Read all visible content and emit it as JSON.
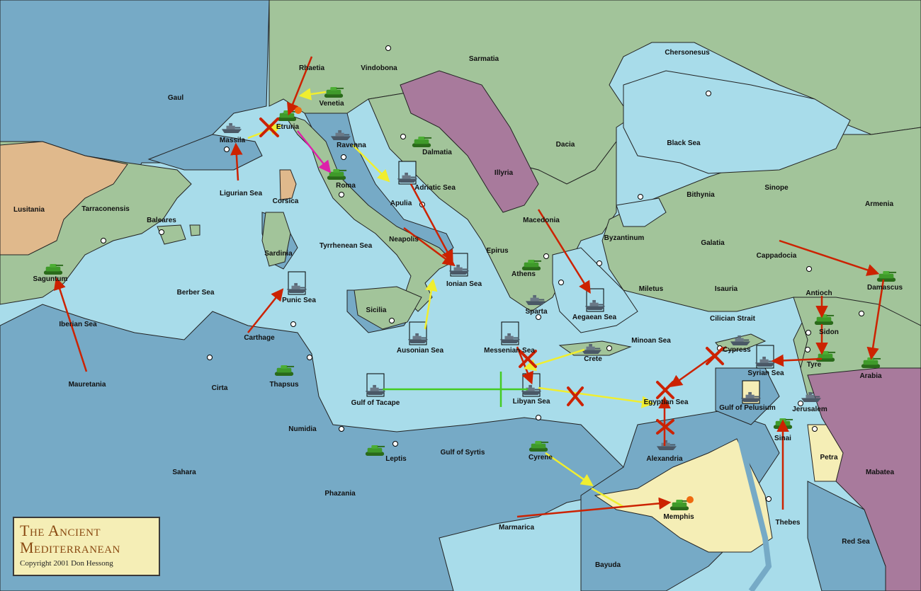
{
  "title": {
    "line1": "The Ancient",
    "line2": "Mediterranean",
    "copyright": "Copyright  2001  Don Hessong"
  },
  "colors": {
    "sea_light": "#a8dcea",
    "sea_dark": "#76aac6",
    "land_green": "#a2c49a",
    "land_lowland": "#9ebfa0",
    "land_tan": "#e0b98c",
    "land_purple": "#a87a9c",
    "land_yellow": "#f5eeb6",
    "order_red": "#cc2200",
    "order_yellow": "#f0ee30",
    "order_magenta": "#dd22aa",
    "order_green": "#44cc22"
  },
  "regions": [
    "Gaul",
    "Rhaetia",
    "Vindobona",
    "Sarmatia",
    "Chersonesus",
    "Venetia",
    "Etruria",
    "Massila",
    "Ravenna",
    "Dalmatia",
    "Dacia",
    "Black Sea",
    "Illyria",
    "Roma",
    "Adriatic Sea",
    "Ligurian Sea",
    "Corsica",
    "Lusitania",
    "Tarraconensis",
    "Baleares",
    "Apulia",
    "Macedonia",
    "Bithynia",
    "Sinope",
    "Armenia",
    "Sardinia",
    "Tyrrhenean Sea",
    "Neapolis",
    "Byzantinum",
    "Galatia",
    "Epirus",
    "Cappadocia",
    "Saguntum",
    "Athens",
    "Ionian Sea",
    "Miletus",
    "Isauria",
    "Berber Sea",
    "Punic Sea",
    "Sparta",
    "Aegaean Sea",
    "Antioch",
    "Damascus",
    "Sicilia",
    "Cilician Strait",
    "Iberian Sea",
    "Carthage",
    "Sidon",
    "Ausonian Sea",
    "Messenian Sea",
    "Minoan Sea",
    "Cypress",
    "Crete",
    "Tyre",
    "Syrian Sea",
    "Mauretania",
    "Thapsus",
    "Arabia",
    "Gulf of Tacape",
    "Libyan Sea",
    "Egyptian Sea",
    "Cirta",
    "Gulf of Pelusium",
    "Jerusalem",
    "Numidia",
    "Sinai",
    "Petra",
    "Leptis",
    "Gulf of Syrtis",
    "Alexandria",
    "Cyrene",
    "Mabatea",
    "Sahara",
    "Phazania",
    "Memphis",
    "Thebes",
    "Marmarica",
    "Red Sea",
    "Bayuda"
  ],
  "units": {
    "armies": [
      "Venetia",
      "Etruria",
      "Dalmatia",
      "Roma",
      "Saguntum",
      "Athens",
      "Thapsus",
      "Leptis",
      "Cyrene",
      "Memphis",
      "Antioch",
      "Sidon",
      "Tyre",
      "Damascus",
      "Arabia",
      "Sinai"
    ],
    "fleets": [
      "Massila",
      "Ravenna",
      "Adriatic Sea",
      "Ionian Sea",
      "Punic Sea",
      "Sparta",
      "Aegaean Sea",
      "Ausonian Sea",
      "Messenian Sea",
      "Gulf of Tacape",
      "Libyan Sea",
      "Crete",
      "Cypress",
      "Syrian Sea",
      "Gulf of Pelusium",
      "Alexandria",
      "Jerusalem"
    ]
  }
}
